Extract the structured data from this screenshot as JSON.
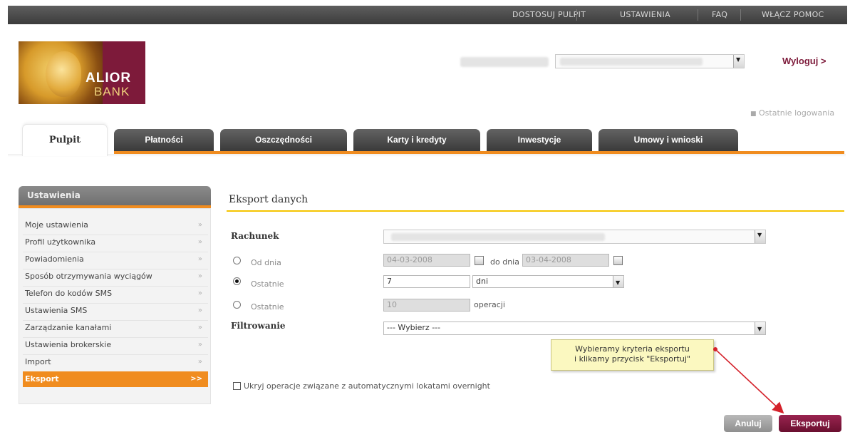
{
  "topnav": {
    "items": [
      "DOSTOSUJ PULPIT",
      "USTAWIENIA",
      "FAQ",
      "WŁĄCZ POMOC"
    ]
  },
  "logo": {
    "line1": "ALIOR",
    "line2": "BANK"
  },
  "header": {
    "logout": "Wyloguj >",
    "last_login": "Ostatnie logowania"
  },
  "tabs": [
    "Pulpit",
    "Płatności",
    "Oszczędności",
    "Karty i kredyty",
    "Inwestycje",
    "Umowy i wnioski"
  ],
  "sidebar": {
    "title": "Ustawienia",
    "items": [
      "Moje ustawienia",
      "Profil użytkownika",
      "Powiadomienia",
      "Sposób otrzymywania wyciągów",
      "Telefon do kodów SMS",
      "Ustawienia SMS",
      "Zarządzanie kanałami",
      "Ustawienia brokerskie",
      "Import",
      "Eksport"
    ],
    "arrow": "»",
    "active_arrow": ">>"
  },
  "main": {
    "title": "Eksport danych",
    "account_label": "Rachunek",
    "from_label": "Od dnia",
    "from_date": "04-03-2008",
    "to_label": "do dnia",
    "to_date": "03-04-2008",
    "last_label": "Ostatnie",
    "last_value": "7",
    "last_unit": "dni",
    "last2_label": "Ostatnie",
    "last2_value": "10",
    "last2_unit": "operacji",
    "filter_label": "Filtrowanie",
    "filter_value": "--- Wybierz ---",
    "hide_overnight": "Ukryj operacje związane z automatycznymi lokatami overnight"
  },
  "tooltip": {
    "line1": "Wybieramy kryteria eksportu",
    "line2": "i klikamy przycisk \"Eksportuj\""
  },
  "buttons": {
    "cancel": "Anuluj",
    "export": "Eksportuj"
  },
  "colors": {
    "brand": "#7d1a3a",
    "accent": "#f08c1f",
    "rule": "#f5c400",
    "tooltip_bg": "#fbf8c0",
    "arrow": "#d4212a"
  }
}
